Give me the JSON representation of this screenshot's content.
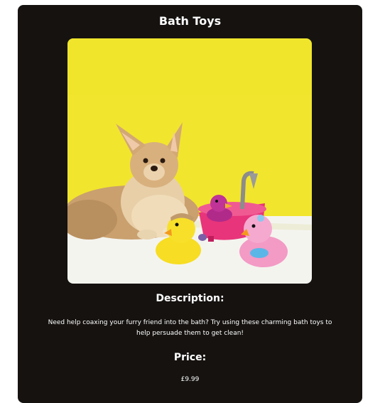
{
  "product": {
    "title": "Bath Toys",
    "image_alt": "Dog with rubber ducks and a pink toy bathtub",
    "description_heading": "Description:",
    "description": "Need help coaxing your furry friend into the bath? Try using these charming bath toys to help persuade them to get clean!",
    "price_heading": "Price:",
    "price": "£9.99"
  },
  "colors": {
    "card_background": "#151210",
    "text": "#ffffff",
    "photo_background": "#f2e52d"
  }
}
